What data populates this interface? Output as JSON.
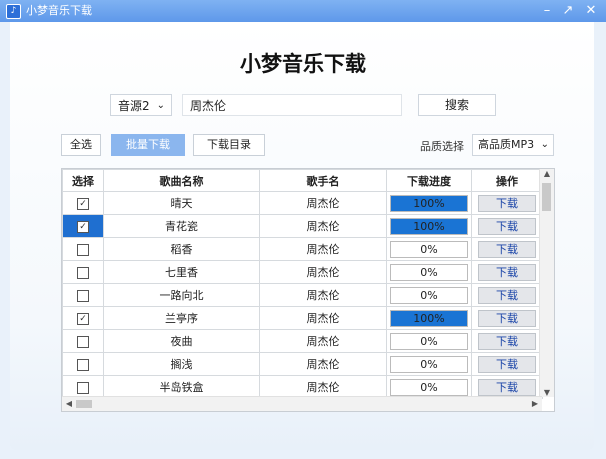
{
  "window": {
    "title": "小梦音乐下载",
    "controls": [
      "–",
      "↗",
      "✕"
    ]
  },
  "heading": "小梦音乐下载",
  "search": {
    "source": "音源2",
    "query": "周杰伦",
    "button": "搜索"
  },
  "toolbar": {
    "select_all": "全选",
    "batch_download": "批量下载",
    "download_dir": "下载目录",
    "quality_label": "品质选择",
    "quality_value": "高品质MP3"
  },
  "table": {
    "headers": [
      "选择",
      "歌曲名称",
      "歌手名",
      "下载进度",
      "操作"
    ],
    "rows": [
      {
        "checked": true,
        "active": false,
        "song": "晴天",
        "artist": "周杰伦",
        "progress": 100,
        "progress_text": "100%",
        "action": "下载"
      },
      {
        "checked": true,
        "active": true,
        "song": "青花瓷",
        "artist": "周杰伦",
        "progress": 100,
        "progress_text": "100%",
        "action": "下载"
      },
      {
        "checked": false,
        "active": false,
        "song": "稻香",
        "artist": "周杰伦",
        "progress": 0,
        "progress_text": "0%",
        "action": "下载"
      },
      {
        "checked": false,
        "active": false,
        "song": "七里香",
        "artist": "周杰伦",
        "progress": 0,
        "progress_text": "0%",
        "action": "下载"
      },
      {
        "checked": false,
        "active": false,
        "song": "一路向北",
        "artist": "周杰伦",
        "progress": 0,
        "progress_text": "0%",
        "action": "下载"
      },
      {
        "checked": true,
        "active": false,
        "song": "兰亭序",
        "artist": "周杰伦",
        "progress": 100,
        "progress_text": "100%",
        "action": "下载"
      },
      {
        "checked": false,
        "active": false,
        "song": "夜曲",
        "artist": "周杰伦",
        "progress": 0,
        "progress_text": "0%",
        "action": "下载"
      },
      {
        "checked": false,
        "active": false,
        "song": "搁浅",
        "artist": "周杰伦",
        "progress": 0,
        "progress_text": "0%",
        "action": "下载"
      },
      {
        "checked": false,
        "active": false,
        "song": "半岛铁盒",
        "artist": "周杰伦",
        "progress": 0,
        "progress_text": "0%",
        "action": "下载"
      }
    ]
  },
  "colors": {
    "accent": "#1a74d4",
    "selected_cell": "#1f6fd0",
    "primary_button": "#8bb6ee"
  }
}
